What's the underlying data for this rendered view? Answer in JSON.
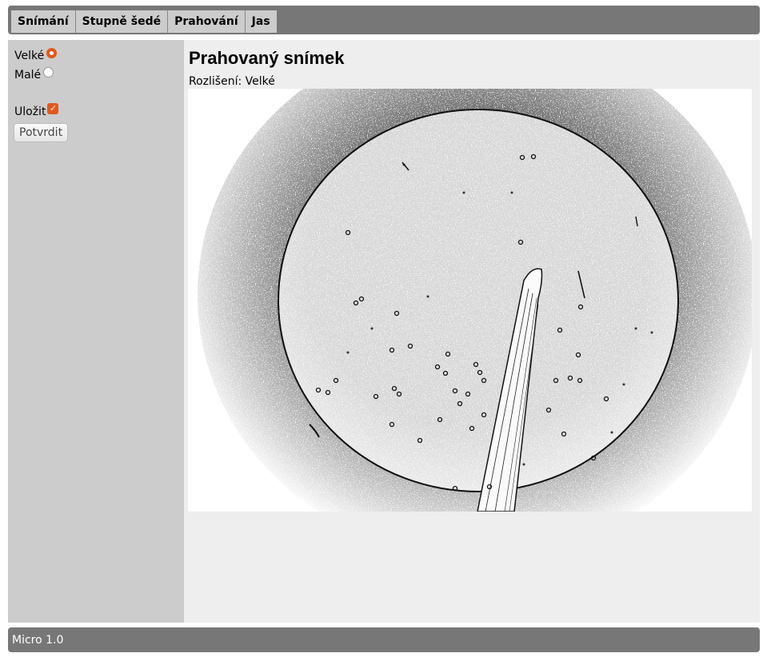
{
  "nav": {
    "tabs": [
      {
        "label": "Snímání"
      },
      {
        "label": "Stupně šedé"
      },
      {
        "label": "Prahování"
      },
      {
        "label": "Jas"
      }
    ]
  },
  "sidebar": {
    "size_options": [
      {
        "label": "Velké",
        "checked": true
      },
      {
        "label": "Malé",
        "checked": false
      }
    ],
    "save": {
      "label": "Uložit",
      "checked": true
    },
    "confirm_label": "Potvrdit"
  },
  "main": {
    "title": "Prahovaný snímek",
    "resolution_text": "Rozlišení: Velké"
  },
  "footer": {
    "text": "Micro 1.0"
  },
  "colors": {
    "bar": "#777777",
    "sidebar": "#cccccc",
    "content": "#eeeeee",
    "accent": "#e4571b"
  }
}
